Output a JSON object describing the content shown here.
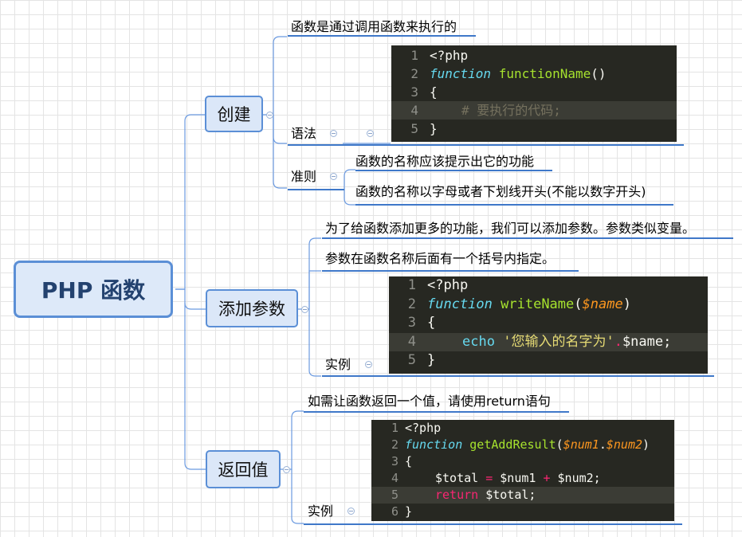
{
  "root": {
    "label": "PHP 函数"
  },
  "branches": {
    "create": {
      "label": "创建",
      "intro": "函数是通过调用函数来执行的",
      "syntax_label": "语法",
      "rules_label": "准则",
      "rules": [
        "函数的名称应该提示出它的功能",
        "函数的名称以字母或者下划线开头(不能以数字开头)"
      ],
      "code": {
        "line_numbers": [
          "1",
          "2",
          "3",
          "4",
          "5"
        ],
        "l1": "<?php",
        "l2_kw": "function",
        "l2_fn": "functionName",
        "l2_rest": "()",
        "l3": "{",
        "l4_comment": "# 要执行的代码;",
        "l5": "}"
      }
    },
    "params": {
      "label": "添加参数",
      "desc1": "为了给函数添加更多的功能，我们可以添加参数。参数类似变量。",
      "desc2": "参数在函数名称后面有一个括号内指定。",
      "example_label": "实例",
      "code": {
        "line_numbers": [
          "1",
          "2",
          "3",
          "4",
          "5"
        ],
        "l1": "<?php",
        "l2_kw": "function",
        "l2_fn": "writeName",
        "l2_p1": "(",
        "l2_var": "$name",
        "l2_p2": ")",
        "l3": "{",
        "l4_kw": "echo",
        "l4_str": "'您输入的名字为'",
        "l4_op": ".",
        "l4_rest": "$name;",
        "l5": "}"
      }
    },
    "returns": {
      "label": "返回值",
      "desc": "如需让函数返回一个值，请使用return语句",
      "example_label": "实例",
      "code": {
        "line_numbers": [
          "1",
          "2",
          "3",
          "4",
          "5",
          "6"
        ],
        "l1": "<?php",
        "l2_kw": "function",
        "l2_fn": "getAddResult",
        "l2_p1": "(",
        "l2_v1": "$num1",
        "l2_dot": ".",
        "l2_v2": "$num2",
        "l2_p2": ")",
        "l3": "{",
        "l4_a": "$total",
        "l4_eq": "=",
        "l4_b": "$num1",
        "l4_plus": "+",
        "l4_c": "$num2;",
        "l5_kw": "return",
        "l5_rest": "$total;",
        "l6": "}"
      }
    }
  },
  "colors": {
    "node_border": "#5b8fd6",
    "node_fill": "#dbe7f8",
    "line": "#4f86d1",
    "code_bg": "#272822"
  }
}
